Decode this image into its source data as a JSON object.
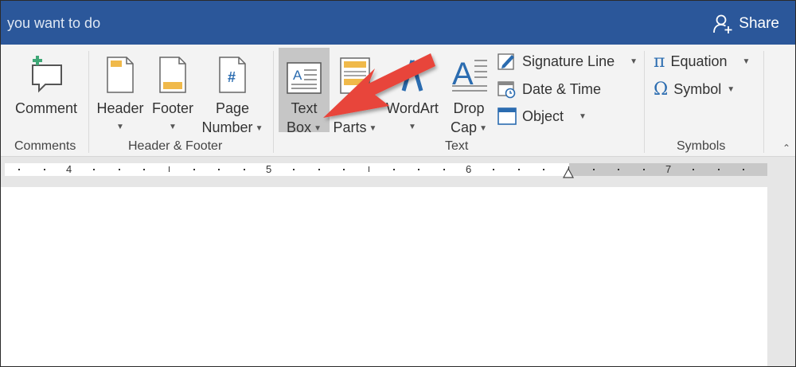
{
  "titlebar": {
    "tell_me": "you want to do",
    "share_label": "Share"
  },
  "ribbon": {
    "groups": {
      "comments": "Comments",
      "header_footer": "Header & Footer",
      "text": "Text",
      "symbols": "Symbols"
    },
    "comment": {
      "label": "Comment"
    },
    "header": {
      "label": "Header"
    },
    "footer": {
      "label": "Footer"
    },
    "page_number": {
      "line1": "Page",
      "line2": "Number"
    },
    "text_box": {
      "line1": "Text",
      "line2": "Box"
    },
    "quick_parts": {
      "line2": "Parts"
    },
    "wordart": {
      "label": "WordArt"
    },
    "drop_cap": {
      "line1": "Drop",
      "line2": "Cap"
    },
    "signature_line": "Signature Line",
    "date_time": "Date & Time",
    "object": "Object",
    "equation": "Equation",
    "symbol": "Symbol",
    "page_number_icon_glyph": "#",
    "equation_glyph": "π",
    "symbol_glyph": "Ω"
  },
  "ruler": {
    "numbers": [
      "4",
      "5",
      "6",
      "7"
    ]
  },
  "colors": {
    "title_bar": "#2b579a",
    "arrow": "#e8443a",
    "selected": "#c6c6c6"
  }
}
